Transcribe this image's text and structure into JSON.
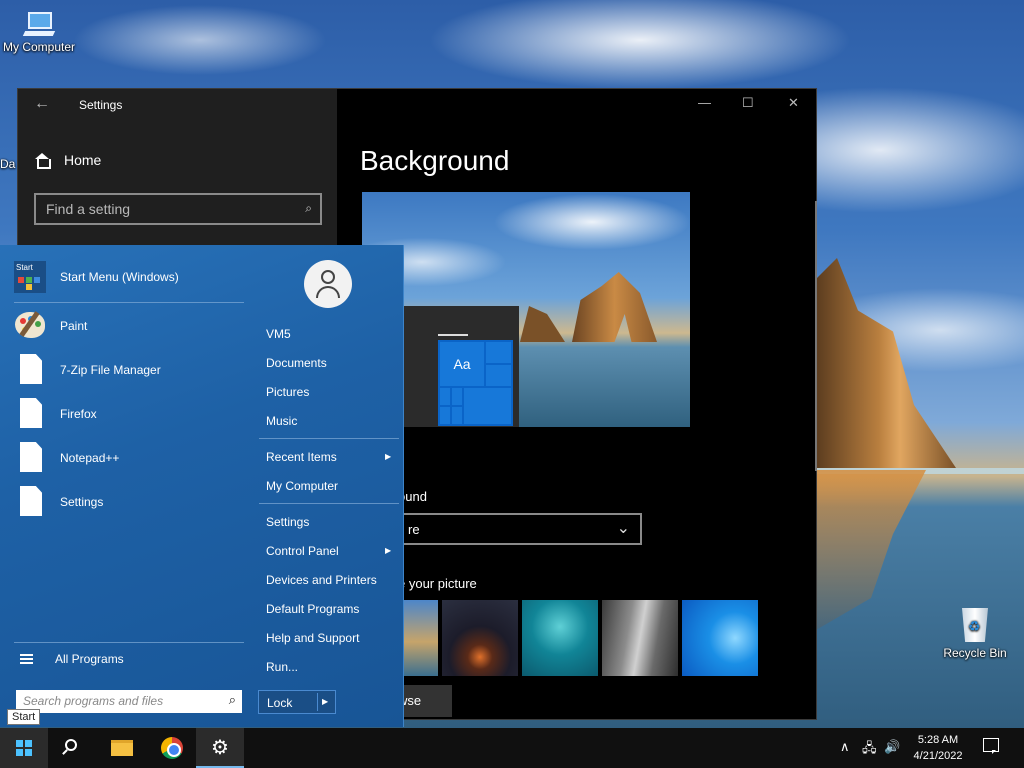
{
  "desktop": {
    "icons": [
      {
        "label": "My Computer"
      },
      {
        "label": "Recycle Bin"
      }
    ],
    "partial_label": "Da"
  },
  "settings_window": {
    "title": "Settings",
    "back_glyph": "←",
    "home_label": "Home",
    "search_placeholder": "Find a setting",
    "page_title": "Background",
    "preview_tile_text": "Aa",
    "background_label": "ound",
    "background_value": "re",
    "choose_picture_label": "e your picture",
    "browse_label": "wse",
    "controls": {
      "minimize": "—",
      "maximize": "☐",
      "close": "✕"
    }
  },
  "start_menu": {
    "pinned": [
      {
        "label": "Start Menu (Windows)",
        "icon": "start-menu-icon"
      },
      {
        "label": "Paint",
        "icon": "paint-icon"
      },
      {
        "label": "7-Zip File Manager",
        "icon": "document-icon"
      },
      {
        "label": "Firefox",
        "icon": "document-icon"
      },
      {
        "label": "Notepad++",
        "icon": "document-icon"
      },
      {
        "label": "Settings",
        "icon": "document-icon"
      }
    ],
    "start_icon_text": "Start",
    "all_programs": "All Programs",
    "search_placeholder": "Search programs and files",
    "right_items": [
      {
        "label": "VM5"
      },
      {
        "label": "Documents"
      },
      {
        "label": "Pictures"
      },
      {
        "label": "Music"
      },
      {
        "label": "Recent Items",
        "submenu": true
      },
      {
        "label": "My Computer"
      },
      {
        "label": "Settings"
      },
      {
        "label": "Control Panel",
        "submenu": true
      },
      {
        "label": "Devices and Printers"
      },
      {
        "label": "Default Programs"
      },
      {
        "label": "Help and Support"
      },
      {
        "label": "Run..."
      }
    ],
    "lock_label": "Lock",
    "tooltip": "Start"
  },
  "taskbar": {
    "time": "5:28 AM",
    "date": "4/21/2022",
    "tray_chevron": "∧",
    "network_glyph": "🖧",
    "volume_glyph": "🔊"
  }
}
